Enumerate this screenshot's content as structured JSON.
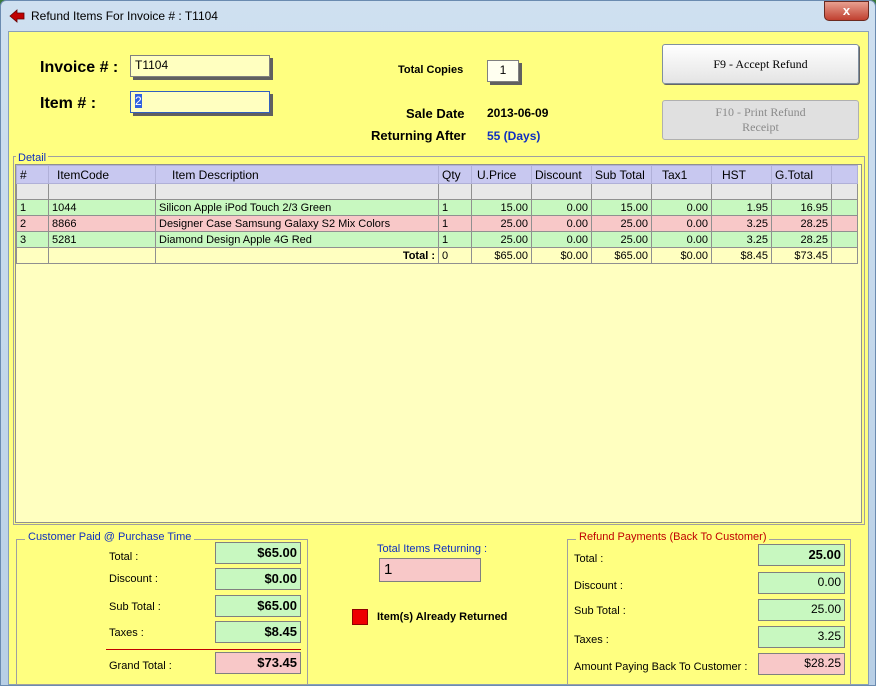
{
  "window": {
    "title": "Refund Items For Invoice # : T1104",
    "close_label": "x"
  },
  "header": {
    "invoice_label": "Invoice # :",
    "invoice_value": "T1104",
    "item_label": "Item # :",
    "item_value": "2",
    "total_copies_label": "Total Copies",
    "total_copies_value": "1",
    "sale_date_label": "Sale Date",
    "sale_date_value": "2013-06-09",
    "returning_after_label": "Returning After",
    "returning_after_value": "55 (Days)"
  },
  "buttons": {
    "accept": "F9 - Accept Refund",
    "print_line1": "F10 -   Print  Refund",
    "print_line2": "Receipt"
  },
  "detail": {
    "legend": "Detail",
    "columns": [
      "#",
      "ItemCode",
      "Item Description",
      "Qty",
      "U.Price",
      "Discount",
      "Sub Total",
      "Tax1",
      "HST",
      "G.Total"
    ],
    "rows": [
      {
        "n": "1",
        "code": "1044",
        "desc": "Silicon Apple iPod Touch 2/3 Green",
        "qty": "1",
        "price": "15.00",
        "disc": "0.00",
        "sub": "15.00",
        "tax1": "0.00",
        "hst": "1.95",
        "gtotal": "16.95"
      },
      {
        "n": "2",
        "code": "8866",
        "desc": "Designer Case Samsung Galaxy S2 Mix Colors",
        "qty": "1",
        "price": "25.00",
        "disc": "0.00",
        "sub": "25.00",
        "tax1": "0.00",
        "hst": "3.25",
        "gtotal": "28.25"
      },
      {
        "n": "3",
        "code": "5281",
        "desc": "Diamond Design Apple 4G Red",
        "qty": "1",
        "price": "25.00",
        "disc": "0.00",
        "sub": "25.00",
        "tax1": "0.00",
        "hst": "3.25",
        "gtotal": "28.25"
      }
    ],
    "totals": {
      "label": "Total :",
      "qty": "0",
      "price": "$65.00",
      "disc": "$0.00",
      "sub": "$65.00",
      "tax1": "$0.00",
      "hst": "$8.45",
      "gtotal": "$73.45"
    }
  },
  "customer_paid": {
    "legend": "Customer Paid @ Purchase Time",
    "total_label": "Total :",
    "total": "$65.00",
    "discount_label": "Discount :",
    "discount": "$0.00",
    "subtotal_label": "Sub Total :",
    "subtotal": "$65.00",
    "taxes_label": "Taxes :",
    "taxes": "$8.45",
    "grand_label": "Grand Total :",
    "grand": "$73.45"
  },
  "middle": {
    "items_returning_label": "Total Items Returning :",
    "items_returning_value": "1",
    "legend_text": "Item(s) Already Returned",
    "legend_color": "#ee0000"
  },
  "refund": {
    "legend": "Refund Payments (Back To Customer)",
    "total_label": "Total :",
    "total": "25.00",
    "discount_label": "Discount :",
    "discount": "0.00",
    "subtotal_label": "Sub Total :",
    "subtotal": "25.00",
    "taxes_label": "Taxes :",
    "taxes": "3.25",
    "paying_label": "Amount Paying Back To Customer :",
    "paying": "$28.25"
  }
}
